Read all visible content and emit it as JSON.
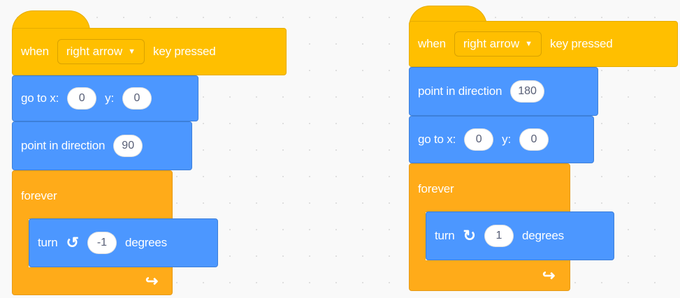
{
  "colors": {
    "events": "#ffbf00",
    "motion": "#4c97ff",
    "control": "#ffab19",
    "canvas": "#f9f9f9"
  },
  "scripts": [
    {
      "hat": {
        "when": "when",
        "key": "right arrow",
        "pressed": "key pressed"
      },
      "goto": {
        "label": "go to x:",
        "x": "0",
        "y_label": "y:",
        "y": "0"
      },
      "point": {
        "label": "point in direction",
        "value": "90"
      },
      "forever": {
        "label": "forever"
      },
      "turn": {
        "label": "turn",
        "icon": "rotate-left-icon",
        "value": "-1",
        "unit": "degrees"
      }
    },
    {
      "hat": {
        "when": "when",
        "key": "right arrow",
        "pressed": "key pressed"
      },
      "point": {
        "label": "point in direction",
        "value": "180"
      },
      "goto": {
        "label": "go to x:",
        "x": "0",
        "y_label": "y:",
        "y": "0"
      },
      "forever": {
        "label": "forever"
      },
      "turn": {
        "label": "turn",
        "icon": "rotate-right-icon",
        "value": "1",
        "unit": "degrees"
      }
    }
  ]
}
